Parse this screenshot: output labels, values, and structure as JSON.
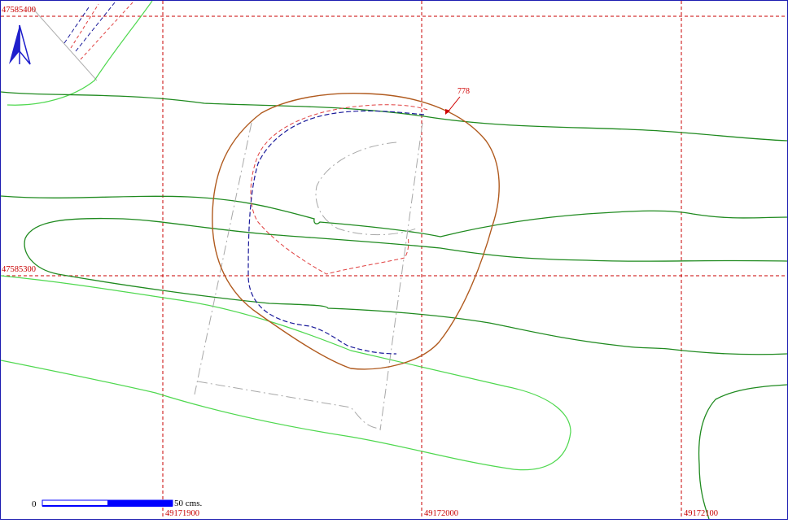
{
  "map": {
    "north_arrow": {
      "label": "",
      "color": "#1f1fcc"
    },
    "grid": {
      "color": "#c80000",
      "x_labels": [
        "49171900",
        "49172000",
        "49172100"
      ],
      "y_labels": [
        "47585400",
        "47585300"
      ]
    },
    "annotation": {
      "label": "778",
      "color": "#d00000"
    },
    "scale_bar": {
      "start_label": "0",
      "end_label": "50 cms.",
      "color": "#0000ff"
    },
    "colors": {
      "contour_dark": "#1f8a1f",
      "contour_light": "#4fd84f",
      "outline_brown": "#b05a1e",
      "dash_blue": "#1a1a9a",
      "dash_red": "#e04040",
      "dash_gray": "#a0a0a0"
    }
  }
}
